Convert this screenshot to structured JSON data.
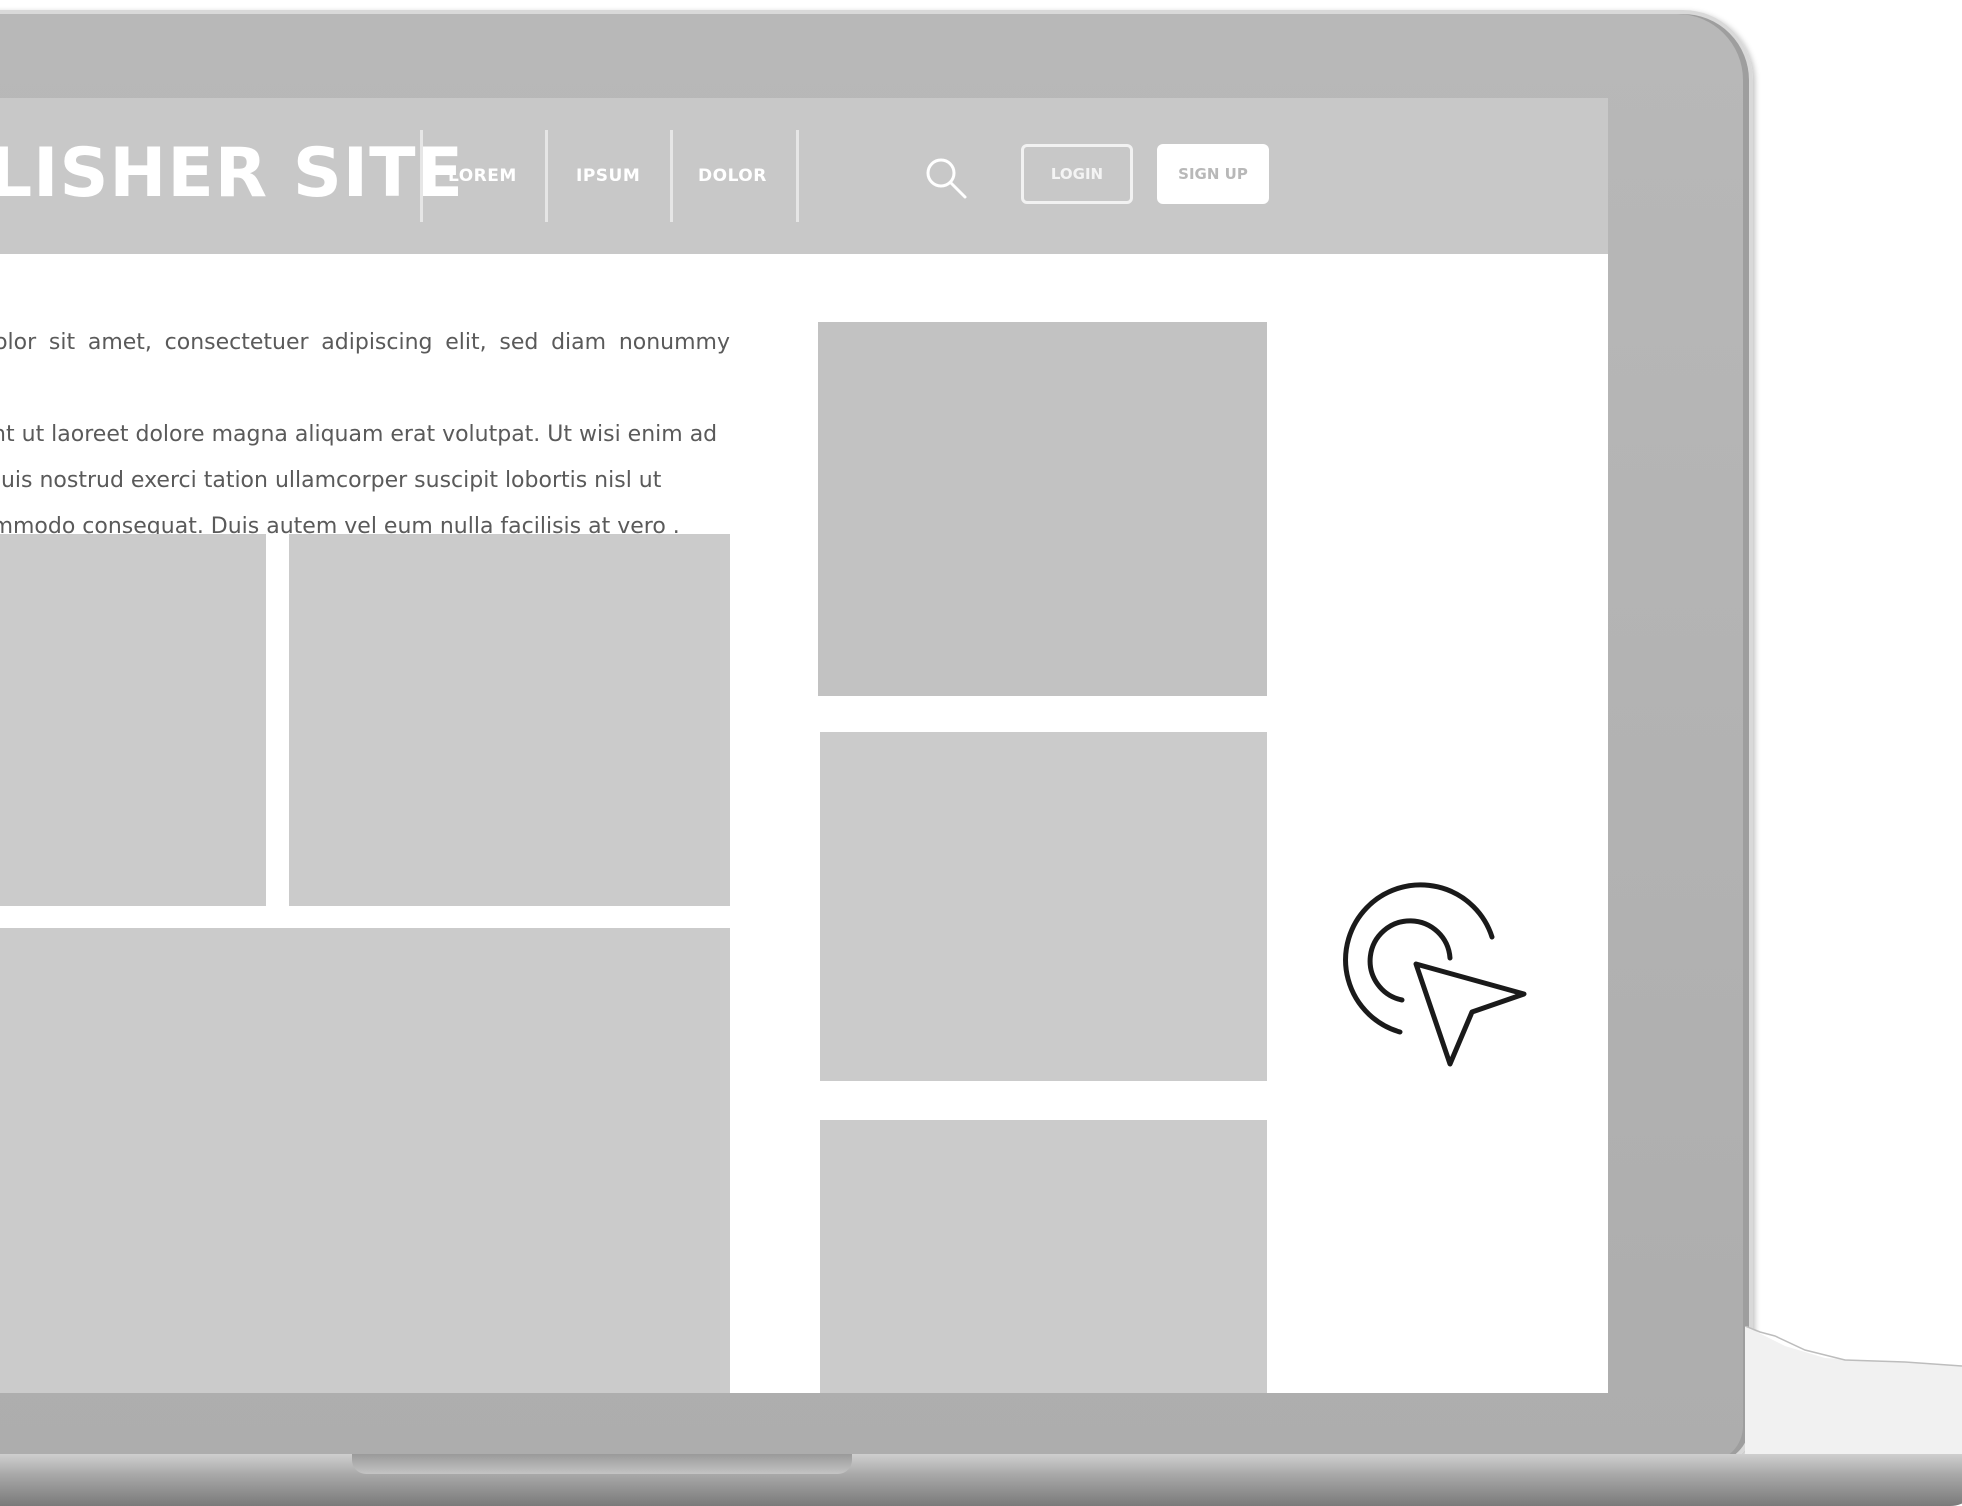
{
  "site": {
    "title": "BLISHER SITE"
  },
  "nav": {
    "items": [
      {
        "label": "LOREM"
      },
      {
        "label": "IPSUM"
      },
      {
        "label": "DOLOR"
      }
    ]
  },
  "header_actions": {
    "search_icon": "search-icon",
    "login_label": "LOGIN",
    "signup_label": "SIGN UP"
  },
  "content": {
    "intro_lines": [
      "um dolor sit amet, consectetuer adipiscing elit, sed diam nonummy nibh",
      "ncidunt ut laoreet dolore magna aliquam erat volutpat. Ut wisi enim ad",
      "iam, quis nostrud exerci tation ullamcorper suscipit lobortis nisl ut",
      "ea commodo consequat. Duis autem vel eum nulla facilisis at vero ."
    ]
  },
  "overlay": {
    "cursor_icon": "click-cursor-icon"
  },
  "colors": {
    "bezel": "#b0b0b0",
    "header": "#c8c8c8",
    "placeholder": "#cbcbcb",
    "text": "#5a5a5a"
  }
}
